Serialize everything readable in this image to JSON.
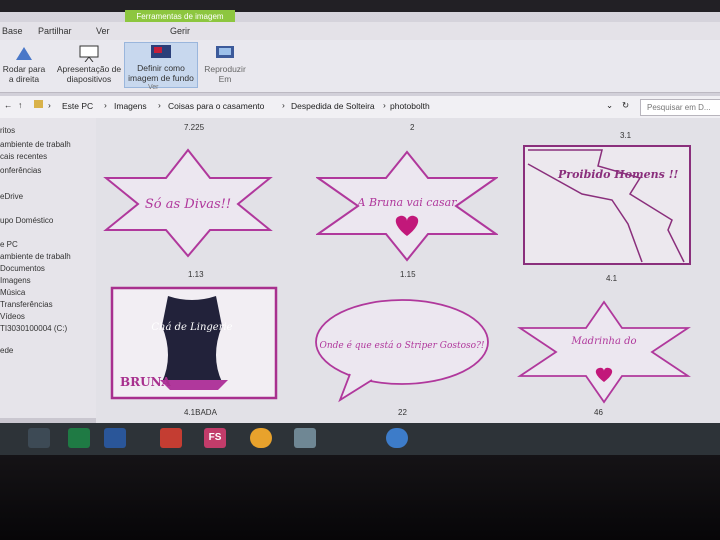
{
  "ribbon": {
    "tabs": [
      "Base",
      "Partilhar",
      "Ver"
    ],
    "context_tab": "Ferramentas de imagem",
    "context_sub": "Gerir",
    "buttons": [
      {
        "label": "Rodar para a direita",
        "icon": "rotate-icon"
      },
      {
        "label": "Apresentação de diapositivos",
        "icon": "slideshow-icon"
      },
      {
        "label": "Definir como imagem de fundo",
        "icon": "wallpaper-icon"
      },
      {
        "label": "Reproduzir Em",
        "icon": "cast-icon"
      }
    ],
    "group_label": "Ver"
  },
  "address": {
    "path": [
      "Este PC",
      "Imagens",
      "Coisas para o casamento",
      "Despedida de Solteira",
      "photobolth"
    ],
    "search_placeholder": "Pesquisar em D..."
  },
  "nav": [
    "ritos",
    "ambiente de trabalh",
    "cais recentes",
    "onferências",
    "eDrive",
    "upo Doméstico",
    "e PC",
    "ambiente de trabalh",
    "Documentos",
    "Imagens",
    "Música",
    "Transferências",
    "Vídeos",
    "TI3030100004 (C:)",
    "ede"
  ],
  "thumbnails": [
    {
      "caption": "7.225",
      "text": "Só as Divas!!"
    },
    {
      "caption": "2",
      "text": "A Bruna vai casar"
    },
    {
      "caption": "3.1",
      "text": "Proibido Homens !!"
    },
    {
      "caption": "1.13",
      "text": "Chá de Lingerie",
      "extra": "BRUNA"
    },
    {
      "caption": "1.15",
      "text": "Onde é que está o Striper Gostoso?!"
    },
    {
      "caption": "4.1",
      "text": "Madrinha do"
    }
  ],
  "footer_captions": [
    "4.1BADA",
    "22",
    "46"
  ],
  "taskbar": {
    "apps": [
      "file-explorer-icon",
      "excel-icon",
      "word-icon",
      "presentation-icon",
      "fs-app-icon",
      "chrome-icon",
      "paint-icon",
      "ie-icon"
    ],
    "fs_label": "FS"
  },
  "colors": {
    "accent": "#b0389c",
    "context_tab": "#8dc63f",
    "taskbar": "#2d3338"
  }
}
